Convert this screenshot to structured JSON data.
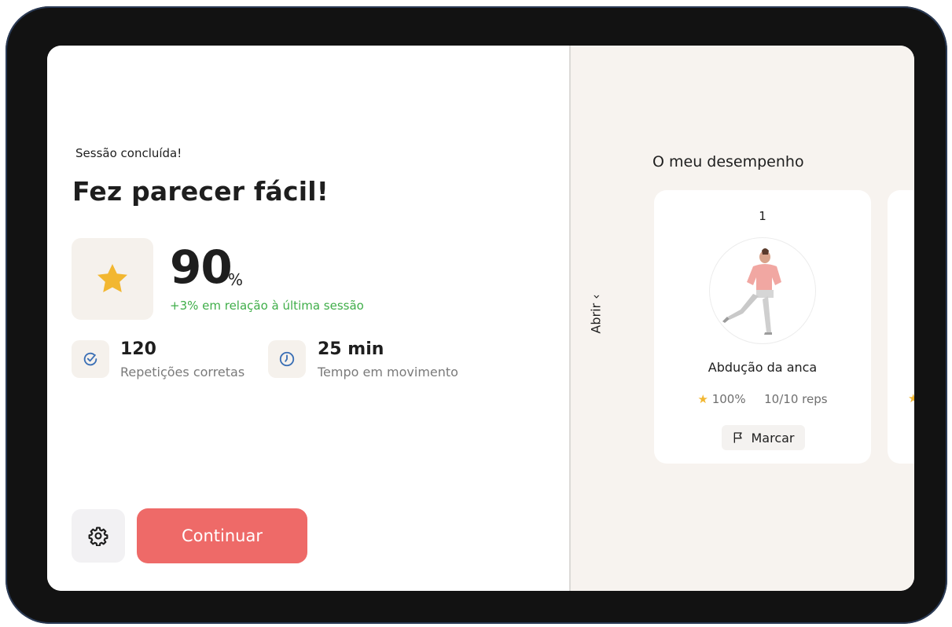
{
  "session": {
    "status": "Sessão concluída!",
    "headline": "Fez parecer fácil!",
    "score_value": "90",
    "score_unit": "%",
    "score_delta": "+3% em relação à última sessão"
  },
  "stats": [
    {
      "icon": "check-circle-icon",
      "value": "120",
      "label": "Repetições corretas"
    },
    {
      "icon": "clock-icon",
      "value": "25 min",
      "label": "Tempo em movimento"
    }
  ],
  "actions": {
    "settings_icon": "gear-icon",
    "continue_label": "Continuar"
  },
  "drawer": {
    "toggle_label": "Abrir ‹"
  },
  "performance": {
    "title": "O meu desempenho",
    "cards": [
      {
        "index": "1",
        "exercise": "Abdução da anca",
        "score": "100%",
        "reps": "10/10 reps",
        "mark_label": "Marcar"
      }
    ]
  },
  "colors": {
    "accent": "#ee6a68",
    "star": "#f2b731",
    "positive": "#3fae49",
    "panel": "#f7f3ef",
    "frame": "#121212"
  }
}
